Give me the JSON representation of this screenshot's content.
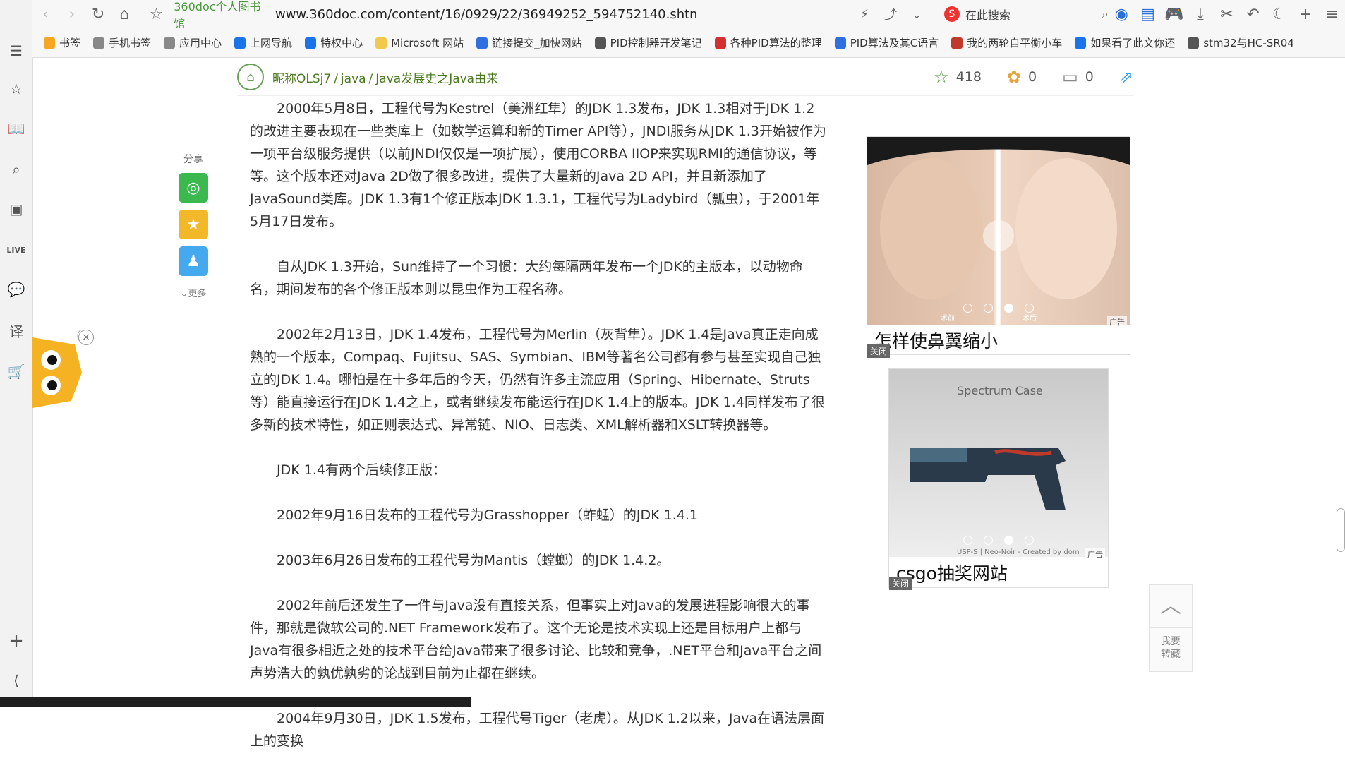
{
  "toolbar": {
    "site_name": "360doc个人图书馆",
    "url": "www.360doc.com/content/16/0929/22/36949252_594752140.shtml",
    "search_placeholder": "在此搜索"
  },
  "bookmarks": [
    {
      "label": "书签",
      "icon": "star-icon",
      "color": "#f5a623"
    },
    {
      "label": "手机书签",
      "icon": "phone-icon",
      "color": "#888888"
    },
    {
      "label": "应用中心",
      "icon": "globe-icon",
      "color": "#888888"
    },
    {
      "label": "上网导航",
      "icon": "e-icon",
      "color": "#1a73e8"
    },
    {
      "label": "特权中心",
      "icon": "badge-icon",
      "color": "#1a73e8"
    },
    {
      "label": "Microsoft 网站",
      "icon": "folder-icon",
      "color": "#f2c94c"
    },
    {
      "label": "链接提交_加快网站",
      "icon": "baidu-icon",
      "color": "#2f6fe0"
    },
    {
      "label": "PID控制器开发笔记",
      "icon": "pen-icon",
      "color": "#555555"
    },
    {
      "label": "各种PID算法的整理",
      "icon": "c-icon",
      "color": "#d32f2f"
    },
    {
      "label": "PID算法及其C语言",
      "icon": "baidu-icon",
      "color": "#2f6fe0"
    },
    {
      "label": "我的两轮自平衡小车",
      "icon": "img-icon",
      "color": "#c0392b"
    },
    {
      "label": "如果看了此文你还",
      "icon": "b-icon",
      "color": "#1a73e8"
    },
    {
      "label": "stm32与HC-SR04",
      "icon": "pen-icon",
      "color": "#555555"
    }
  ],
  "header": {
    "author": "昵称OLSj7",
    "category": "java",
    "title": "Java发展史之Java由来",
    "likes": "418",
    "flowers": "0",
    "comments": "0"
  },
  "share": {
    "label": "分享",
    "more": "更多"
  },
  "article": {
    "p1": "2000年5月8日，工程代号为Kestrel（美洲红隼）的JDK 1.3发布，JDK 1.3相对于JDK 1.2的改进主要表现在一些类库上（如数学运算和新的Timer API等），JNDI服务从JDK 1.3开始被作为一项平台级服务提供（以前JNDI仅仅是一项扩展），使用CORBA IIOP来实现RMI的通信协议，等等。这个版本还对Java 2D做了很多改进，提供了大量新的Java 2D API，并且新添加了JavaSound类库。JDK 1.3有1个修正版本JDK 1.3.1，工程代号为Ladybird（瓢虫），于2001年5月17日发布。",
    "p2": "自从JDK 1.3开始，Sun维持了一个习惯：大约每隔两年发布一个JDK的主版本，以动物命名，期间发布的各个修正版本则以昆虫作为工程名称。",
    "p3": "2002年2月13日，JDK 1.4发布，工程代号为Merlin（灰背隼）。JDK 1.4是Java真正走向成熟的一个版本，Compaq、Fujitsu、SAS、Symbian、IBM等著名公司都有参与甚至实现自己独立的JDK 1.4。哪怕是在十多年后的今天，仍然有许多主流应用（Spring、Hibernate、Struts等）能直接运行在JDK 1.4之上，或者继续发布能运行在JDK 1.4上的版本。JDK 1.4同样发布了很多新的技术特性，如正则表达式、异常链、NIO、日志类、XML解析器和XSLT转换器等。",
    "p4": "JDK 1.4有两个后续修正版：",
    "p5": "2002年9月16日发布的工程代号为Grasshopper（蚱蜢）的JDK 1.4.1",
    "p6": "2003年6月26日发布的工程代号为Mantis（螳螂）的JDK 1.4.2。",
    "p7": "2002年前后还发生了一件与Java没有直接关系，但事实上对Java的发展进程影响很大的事件，那就是微软公司的.NET Framework发布了。这个无论是技术实现上还是目标用户上都与Java有很多相近之处的技术平台给Java带来了很多讨论、比较和竞争，.NET平台和Java平台之间声势浩大的孰优孰劣的论战到目前为止都在继续。",
    "p8": "2004年9月30日，JDK 1.5发布，工程代号Tiger（老虎）。从JDK 1.2以来，Java在语法层面上的变换"
  },
  "ads": {
    "ad1": {
      "caption": "怎样使鼻翼缩小",
      "close": "关闭",
      "tag": "广告",
      "before": "术前",
      "after": "术后"
    },
    "ad2": {
      "caption": "csgo抽奖网站",
      "close": "关闭",
      "tag": "广告",
      "brand": "Spectrum Case",
      "footer": "USP-S | Neo-Noir - Created by dom"
    }
  },
  "backtop": {
    "label1": "我要",
    "label2": "转藏"
  }
}
